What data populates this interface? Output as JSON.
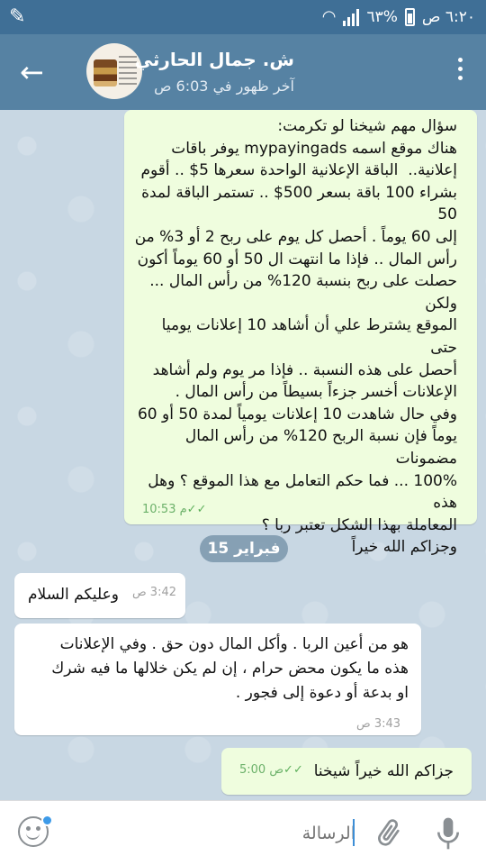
{
  "status_bar": {
    "time": "٦:٢٠ ص",
    "battery": "٦٣%"
  },
  "header": {
    "title": "ش. جمال الحارثي",
    "last_seen": "آخر ظهور في 6:03 ص"
  },
  "messages": [
    {
      "direction": "out",
      "text": "سؤال مهم شيخنا لو تكرمت:\nهناك موقع اسمه mypayingads يوفر باقات\nإعلانية..  الباقة الإعلانية الواحدة سعرها 5$ .. أقوم\nبشراء 100 باقة بسعر 500$ .. تستمر الباقة لمدة 50\nإلى 60 يوماً . أحصل كل يوم على ربح 2 أو 3% من\nرأس المال .. فإذا ما انتهت ال 50 أو 60 يوماً أكون\nحصلت على ربح بنسبة 120% من رأس المال ... ولكن\nالموقع يشترط علي أن أشاهد 10 إعلانات يوميا حتى\nأحصل على هذه النسبة .. فإذا مر يوم ولم أشاهد\nالإعلانات أخسر جزءاً بسيطاً من رأس المال .\nوفي حال شاهدت 10 إعلانات يومياً لمدة 50 أو 60\nيوماً فإن نسبة الربح 120% من رأس المال مضمونات\n100% ... فما حكم التعامل مع هذا الموقع ؟ وهل هذه\nالمعاملة بهذا الشكل تعتبر ربا ؟\nوجزاكم الله خيراً",
      "time": "10:53 م"
    },
    {
      "direction": "in",
      "text": "وعليكم السلام",
      "time": "3:42 ص"
    },
    {
      "direction": "in",
      "text": "هو من أعين الربا . وأكل المال دون حق . وفي الإعلانات\nهذه ما يكون محض حرام ، إن لم يكن خلالها ما فيه شرك\nاو بدعة أو دعوة إلى فجور .",
      "time": "3:43 ص"
    },
    {
      "direction": "out",
      "text": "جزاكم الله خيراً شيخنا",
      "time": "5:00 ص"
    }
  ],
  "date_separator": "فبراير 15",
  "input": {
    "placeholder": "الرسالة"
  },
  "icons": [
    "pencil-icon",
    "wifi-icon",
    "signal-icon",
    "battery-icon",
    "back-arrow-icon",
    "menu-icon",
    "emoji-icon",
    "attach-icon",
    "mic-icon"
  ],
  "colors": {
    "header": "#5682a3",
    "status_bar": "#3f6f96",
    "outgoing_bubble": "#effdde",
    "incoming_bubble": "#ffffff",
    "read_ticks": "#5fb05d"
  }
}
